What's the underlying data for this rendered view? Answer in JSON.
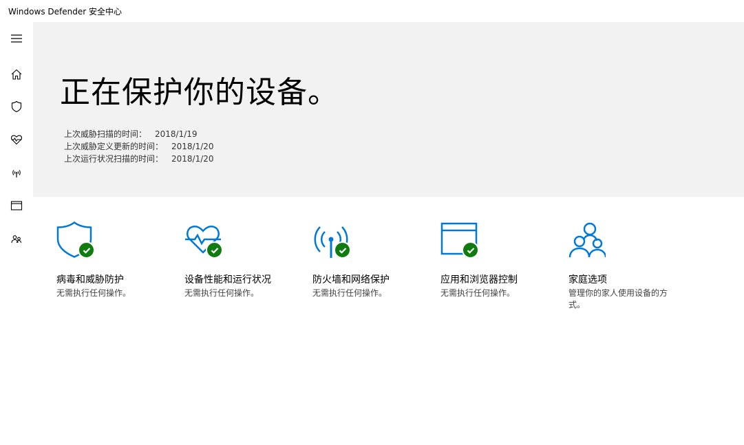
{
  "window": {
    "title": "Windows Defender 安全中心"
  },
  "nav": {
    "items": [
      {
        "name": "menu",
        "icon": "hamburger-icon"
      },
      {
        "name": "home",
        "icon": "home-icon"
      },
      {
        "name": "virus-protection",
        "icon": "shield-icon"
      },
      {
        "name": "device-health",
        "icon": "heart-pulse-icon"
      },
      {
        "name": "firewall",
        "icon": "antenna-icon"
      },
      {
        "name": "app-browser",
        "icon": "browser-window-icon"
      },
      {
        "name": "family",
        "icon": "family-icon"
      }
    ]
  },
  "hero": {
    "heading": "正在保护你的设备。",
    "scans": [
      {
        "label": "上次威胁扫描的时间：",
        "value": "2018/1/19"
      },
      {
        "label": "上次威胁定义更新的时间：",
        "value": "2018/1/20"
      },
      {
        "label": "上次运行状况扫描的时间：",
        "value": "2018/1/20"
      }
    ]
  },
  "tiles": [
    {
      "title": "病毒和威胁防护",
      "desc": "无需执行任何操作。",
      "icon": "shield-icon",
      "status": "ok"
    },
    {
      "title": "设备性能和运行状况",
      "desc": "无需执行任何操作。",
      "icon": "heart-pulse-icon",
      "status": "ok"
    },
    {
      "title": "防火墙和网络保护",
      "desc": "无需执行任何操作。",
      "icon": "antenna-icon",
      "status": "ok"
    },
    {
      "title": "应用和浏览器控制",
      "desc": "无需执行任何操作。",
      "icon": "browser-window-icon",
      "status": "ok"
    },
    {
      "title": "家庭选项",
      "desc": "管理你的家人使用设备的方式。",
      "icon": "family-icon",
      "status": "none"
    }
  ],
  "colors": {
    "accent": "#0078d7",
    "ok": "#107c10",
    "hero_bg": "#f2f2f2"
  }
}
